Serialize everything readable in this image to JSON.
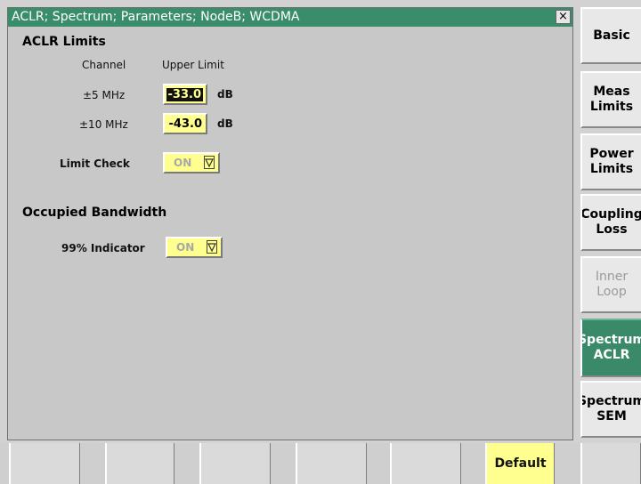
{
  "dialog": {
    "title": "ACLR; Spectrum; Parameters; NodeB; WCDMA",
    "close": "×",
    "aclr_title": "ACLR Limits",
    "col_channel": "Channel",
    "col_upper": "Upper Limit",
    "rows": [
      {
        "channel": "±5 MHz",
        "value": "-33.0",
        "unit": "dB"
      },
      {
        "channel": "±10 MHz",
        "value": "-43.0",
        "unit": "dB"
      }
    ],
    "limit_check_label": "Limit Check",
    "limit_check_value": "ON",
    "obw_title": "Occupied Bandwidth",
    "indicator_label": "99% Indicator",
    "indicator_value": "ON"
  },
  "softkeys": [
    {
      "label": "Basic"
    },
    {
      "label": "Meas\nLimits"
    },
    {
      "label": "Power\nLimits"
    },
    {
      "label": "Coupling\nLoss"
    },
    {
      "label": "Inner\nLoop"
    },
    {
      "label": "Spectrum\nACLR"
    },
    {
      "label": "Spectrum\nSEM"
    }
  ],
  "bottom": {
    "default_label": "Default"
  },
  "colors": {
    "titlebar": "#3a8d6b",
    "field": "#ffff8f",
    "active_key": "#3a8a69"
  }
}
